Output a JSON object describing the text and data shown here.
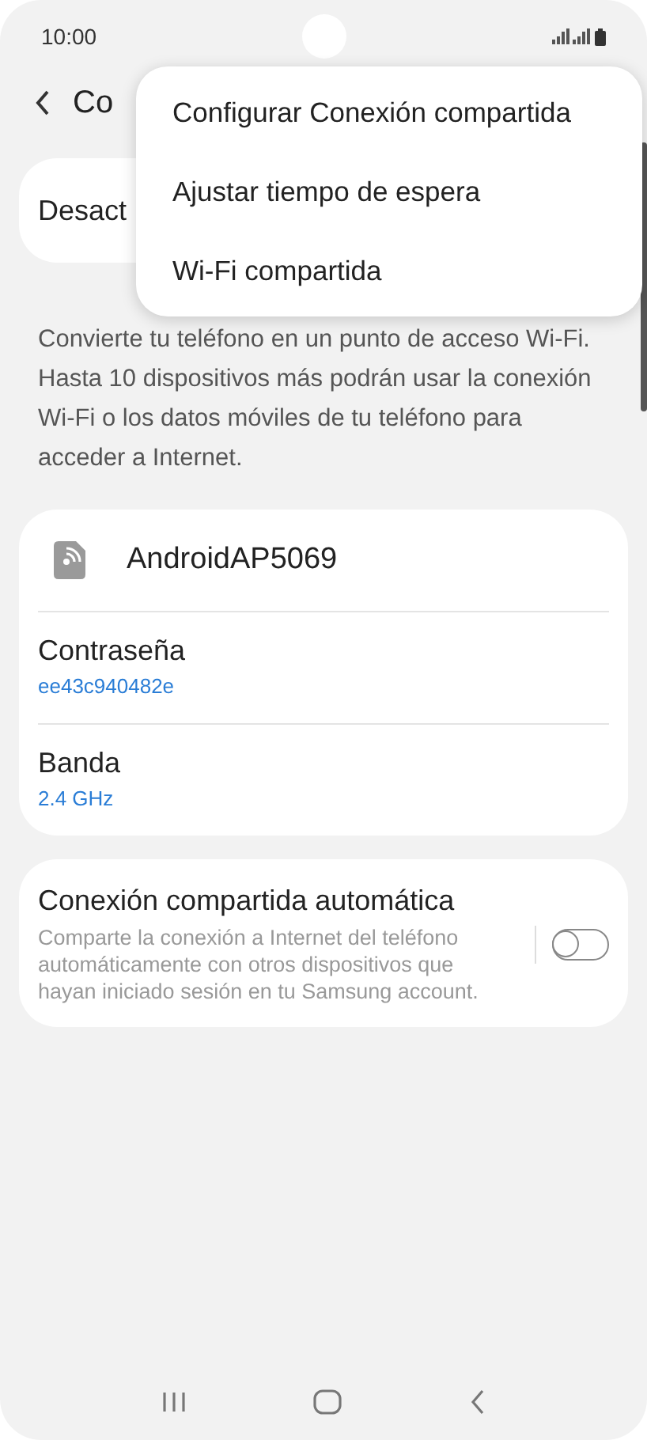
{
  "status_bar": {
    "time": "10:00"
  },
  "header": {
    "title": "Co"
  },
  "main_switch": {
    "label": "Desact"
  },
  "description": "Convierte tu teléfono en un punto de acceso Wi-Fi. Hasta 10 dispositivos más podrán usar la conexión Wi-Fi o los datos móviles de tu teléfono para acceder a Internet.",
  "hotspot": {
    "name": "AndroidAP5069",
    "settings": [
      {
        "label": "Contraseña",
        "value": "ee43c940482e"
      },
      {
        "label": "Banda",
        "value": "2.4 GHz"
      }
    ]
  },
  "auto_hotspot": {
    "title": "Conexión compartida automática",
    "description": "Comparte la conexión a Internet del teléfono automáticamente con otros dispositivos que hayan iniciado sesión en tu Samsung account.",
    "on": false
  },
  "menu": {
    "items": [
      {
        "label": "Configurar Conexión compartida"
      },
      {
        "label": "Ajustar tiempo de espera"
      },
      {
        "label": "Wi-Fi compartida"
      }
    ]
  }
}
